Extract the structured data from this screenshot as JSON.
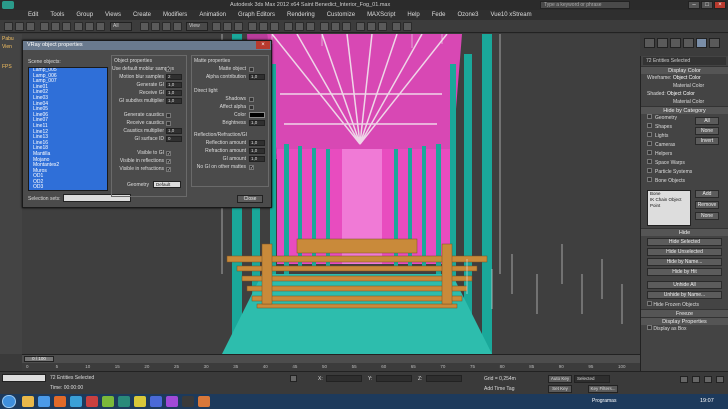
{
  "window": {
    "title": "Autodesk 3ds Max  2012 x64     Saint Benedict_Interior_Fog_01.max",
    "search_placeholder": "Type a keyword or phrase"
  },
  "menu": [
    "Edit",
    "Tools",
    "Group",
    "Views",
    "Create",
    "Modifiers",
    "Animation",
    "Graph Editors",
    "Rendering",
    "Customize",
    "MAXScript",
    "Help",
    "Fede",
    "Ozone3",
    "Vue10 xStream"
  ],
  "toolbar": {
    "selection_filter": "All",
    "view_dropdown": "View"
  },
  "left_strip": [
    "Pabu",
    "Vien",
    "FPS"
  ],
  "dialog": {
    "title": "VRay object properties",
    "scene_objects_label": "Scene objects:",
    "objects": [
      "Lamp_005",
      "Lamp_006",
      "Lamp_007",
      "Line01",
      "Line02",
      "Line03",
      "Line04",
      "Line05",
      "Line06",
      "Line07",
      "Line11",
      "Line12",
      "Line13",
      "Line16",
      "Line18",
      "Mantilla",
      "Mojano",
      "Montantes2",
      "Muros",
      "OD1",
      "OD2",
      "OD3"
    ],
    "selection_sets_label": "Selection sets:",
    "object_properties_label": "Object properties",
    "props": [
      {
        "label": "Use default moblur samples",
        "kind": "check",
        "value": "✓"
      },
      {
        "label": "Motion blur samples",
        "kind": "num",
        "value": "2"
      },
      {
        "label": "Generate GI",
        "kind": "num",
        "value": "1,0"
      },
      {
        "label": "Receive GI",
        "kind": "num",
        "value": "1,0"
      },
      {
        "label": "GI subdivs multiplier",
        "kind": "num",
        "value": "1,0"
      },
      {
        "label": "Generate caustics",
        "kind": "check",
        "value": ""
      },
      {
        "label": "Receive caustics",
        "kind": "check",
        "value": ""
      },
      {
        "label": "Caustics multiplier",
        "kind": "num",
        "value": "1,0"
      },
      {
        "label": "GI surface ID",
        "kind": "num",
        "value": "0"
      },
      {
        "label": "Visible to GI",
        "kind": "check",
        "value": "✓"
      },
      {
        "label": "Visible in reflections",
        "kind": "check",
        "value": "✓"
      },
      {
        "label": "Visible in refractions",
        "kind": "check",
        "value": "✓"
      }
    ],
    "geometry_label": "Geometry",
    "geometry_value": "Default",
    "matte_label": "Matte properties",
    "matte_props": [
      {
        "label": "Matte object",
        "kind": "check",
        "value": ""
      },
      {
        "label": "Alpha contribution",
        "kind": "num",
        "value": "1,0"
      }
    ],
    "direct_light_label": "Direct light",
    "direct_props": [
      {
        "label": "Shadows",
        "kind": "check",
        "value": ""
      },
      {
        "label": "Affect alpha",
        "kind": "check",
        "value": ""
      },
      {
        "label": "Color",
        "kind": "swatch",
        "value": ""
      },
      {
        "label": "Brightness",
        "kind": "num",
        "value": "1,0"
      }
    ],
    "rr_label": "Reflection/Refraction/GI",
    "rr_props": [
      {
        "label": "Reflection amount",
        "kind": "num",
        "value": "1,0"
      },
      {
        "label": "Refraction amount",
        "kind": "num",
        "value": "1,0"
      },
      {
        "label": "GI amount",
        "kind": "num",
        "value": "1,0"
      },
      {
        "label": "No GI on other mattes",
        "kind": "check",
        "value": "✓"
      }
    ],
    "close_label": "Close"
  },
  "command_panel": {
    "entries": "72 Entities Selected",
    "display_color": "Display Color",
    "wireframe": "Wireframe:",
    "shaded": "Shaded:",
    "object_color": "Object Color",
    "material_color": "Material Color",
    "hide_by_category": "Hide by Category",
    "categories": [
      "Geometry",
      "Shapes",
      "Lights",
      "Cameras",
      "Helpers",
      "Space Warps",
      "Particle Systems",
      "Bone Objects"
    ],
    "cat_buttons": [
      "All",
      "None",
      "Invert"
    ],
    "bone_list": [
      "Bone",
      "IK Chain Object",
      "Point"
    ],
    "bone_buttons": [
      "Add",
      "Remove",
      "None"
    ],
    "hide": "Hide",
    "hide_buttons": [
      "Hide Selected",
      "Hide Unselected",
      "Hide by Name...",
      "Hide by Hit",
      "Unhide All",
      "Unhide by Name..."
    ],
    "hide_frozen": "Hide Frozen Objects",
    "freeze": "Freeze",
    "display_properties": "Display Properties",
    "display_as_box": "Display as Box"
  },
  "timeline": {
    "frame": "0 / 100",
    "ticks": [
      "0",
      "5",
      "10",
      "15",
      "20",
      "25",
      "30",
      "35",
      "40",
      "45",
      "50",
      "55",
      "60",
      "65",
      "70",
      "75",
      "80",
      "85",
      "90",
      "95",
      "100"
    ]
  },
  "status": {
    "selected": "72 Entities Selected",
    "prompt": "Time: 00:00:00",
    "x": "X:",
    "y": "Y:",
    "z": "Z:",
    "grid": "Grid = 0,254m",
    "auto_key": "Auto Key",
    "selected_dd": "Selected",
    "set_key": "Set Key",
    "key_filters": "Key Filters...",
    "add_time_tag": "Add Time Tag"
  },
  "taskbar": {
    "lang": "Programas",
    "time": "19:07"
  },
  "colors": {
    "pink": "#e84cbf",
    "teal": "#1aa89a",
    "wood": "#c98a3a",
    "list_blue": "#2f6fd8"
  }
}
